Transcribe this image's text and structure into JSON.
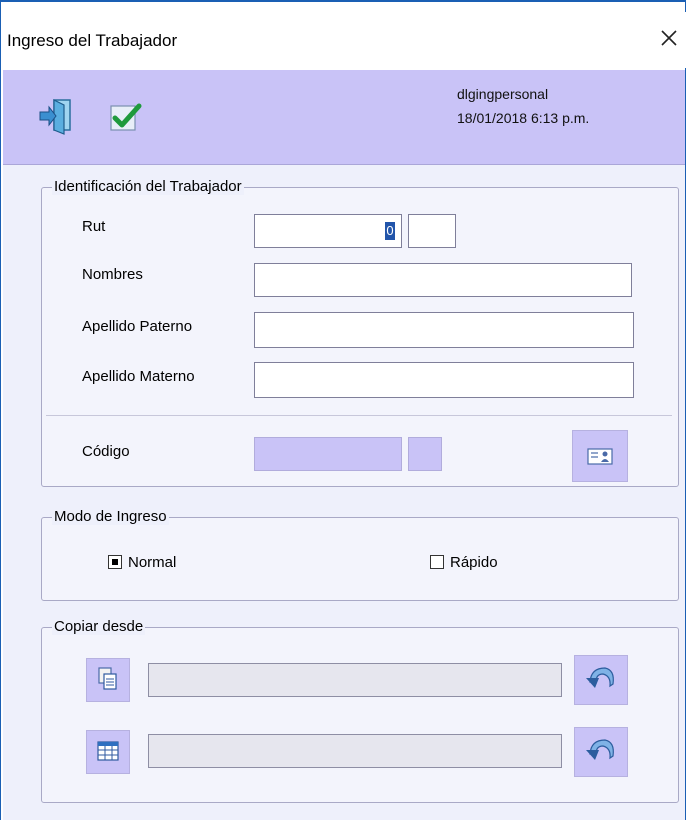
{
  "window": {
    "title": "Ingreso del Trabajador",
    "close_label": "✕"
  },
  "toolbar": {
    "user": "dlgingpersonal",
    "datetime": "18/01/2018 6:13 p.m."
  },
  "identificacion": {
    "legend": "Identificación del Trabajador",
    "rut_label": "Rut",
    "rut_value": "0",
    "rut_dv_value": "",
    "nombres_label": "Nombres",
    "nombres_value": "",
    "apellido_paterno_label": "Apellido Paterno",
    "apellido_paterno_value": "",
    "apellido_materno_label": "Apellido Materno",
    "apellido_materno_value": "",
    "codigo_label": "Código",
    "codigo_value": "",
    "codigo_dv_value": ""
  },
  "modo_ingreso": {
    "legend": "Modo de Ingreso",
    "option_normal": "Normal",
    "option_rapido": "Rápido",
    "selected": "Normal"
  },
  "copiar_desde": {
    "legend": "Copiar desde",
    "field_1_value": "",
    "field_2_value": ""
  },
  "colors": {
    "accent_lavender": "#c9c3f7",
    "window_border": "#1a5fb4"
  }
}
